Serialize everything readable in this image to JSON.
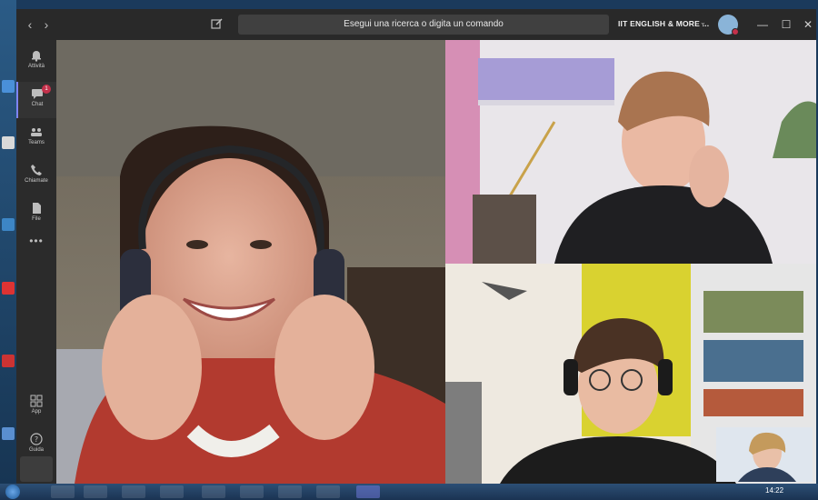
{
  "app": {
    "search_placeholder": "Esegui una ricerca o digita un comando",
    "tenant_name": "IIT ENGLISH & MORE ...",
    "nav_icons": [
      "back-arrow-icon",
      "forward-arrow-icon",
      "compose-icon"
    ],
    "window_controls": [
      "minimize-icon",
      "maximize-icon",
      "close-icon"
    ],
    "accent_color": "#7f85f5"
  },
  "rail": {
    "items": [
      {
        "label": "Attività",
        "icon": "bell-icon"
      },
      {
        "label": "Chat",
        "icon": "chat-icon",
        "badge": "1"
      },
      {
        "label": "Teams",
        "icon": "teams-icon"
      },
      {
        "label": "Chiamate",
        "icon": "phone-icon"
      },
      {
        "label": "File",
        "icon": "file-icon"
      }
    ],
    "more_label": "•••",
    "bottom_items": [
      {
        "label": "App",
        "icon": "apps-icon"
      },
      {
        "label": "Guida",
        "icon": "help-icon"
      }
    ]
  },
  "call": {
    "participants": [
      {
        "name": "participant-1",
        "description_icon": "video-feed"
      },
      {
        "name": "participant-2",
        "description_icon": "video-feed"
      },
      {
        "name": "participant-3",
        "description_icon": "video-feed"
      },
      {
        "name": "self-view",
        "description_icon": "video-feed"
      }
    ]
  },
  "taskbar": {
    "clock": "14:22"
  }
}
